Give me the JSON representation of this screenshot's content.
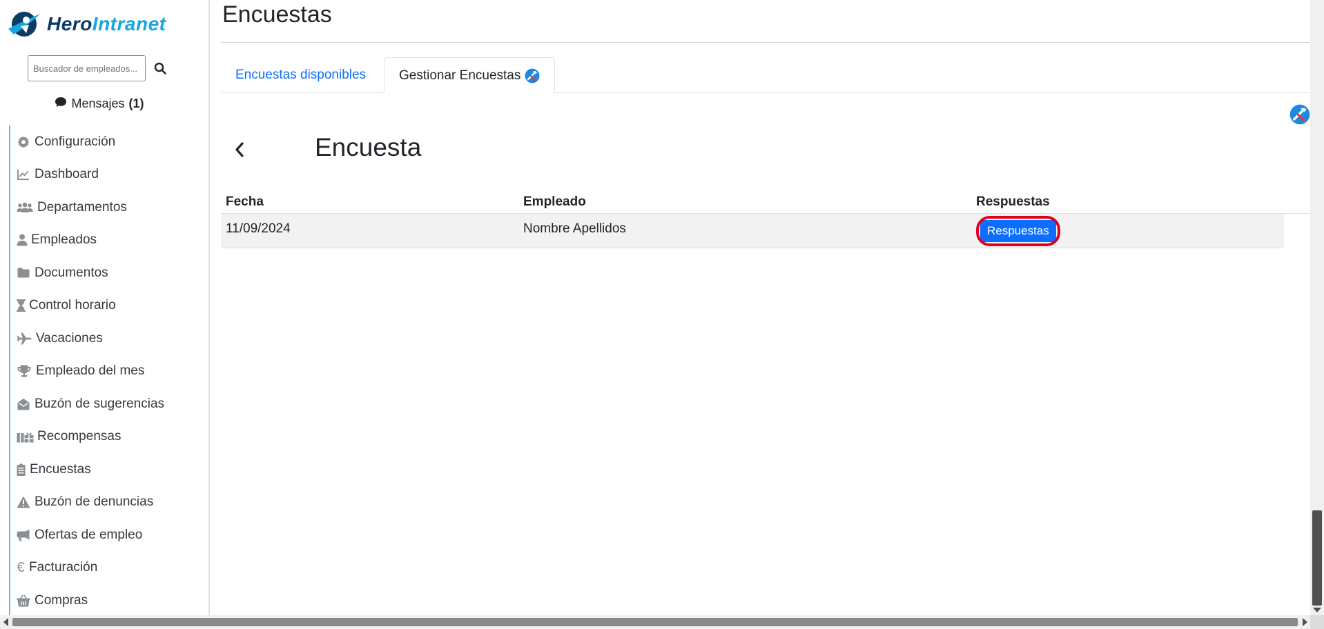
{
  "brand": {
    "part1": "Hero",
    "part2": "Intranet",
    "icon": "hero-logo-icon"
  },
  "search": {
    "placeholder": "Buscador de empleados...",
    "icon": "search-icon"
  },
  "messages": {
    "label": "Mensajes",
    "count": "(1)",
    "icon": "chat-bubble-icon"
  },
  "sidebar": {
    "items": [
      {
        "label": "Configuración",
        "icon": "gear-icon"
      },
      {
        "label": "Dashboard",
        "icon": "chart-line-icon"
      },
      {
        "label": "Departamentos",
        "icon": "users-icon"
      },
      {
        "label": "Empleados",
        "icon": "user-icon"
      },
      {
        "label": "Documentos",
        "icon": "folder-icon"
      },
      {
        "label": "Control horario",
        "icon": "hourglass-icon"
      },
      {
        "label": "Vacaciones",
        "icon": "plane-icon"
      },
      {
        "label": "Empleado del mes",
        "icon": "trophy-icon"
      },
      {
        "label": "Buzón de sugerencias",
        "icon": "envelope-open-icon"
      },
      {
        "label": "Recompensas",
        "icon": "gifts-icon"
      },
      {
        "label": "Encuestas",
        "icon": "clipboard-list-icon"
      },
      {
        "label": "Buzón de denuncias",
        "icon": "warning-icon"
      },
      {
        "label": "Ofertas de empleo",
        "icon": "megaphone-icon"
      },
      {
        "label": "Facturación",
        "icon": "euro-icon"
      },
      {
        "label": "Compras",
        "icon": "basket-icon"
      }
    ]
  },
  "page": {
    "title": "Encuestas"
  },
  "tabs": [
    {
      "label": "Encuestas disponibles",
      "active": false
    },
    {
      "label": "Gestionar Encuestas",
      "active": true,
      "icon": "tools-icon"
    }
  ],
  "survey": {
    "title": "Encuesta",
    "back_icon": "chevron-left-icon"
  },
  "table": {
    "headers": [
      "Fecha",
      "Empleado",
      "Respuestas"
    ],
    "rows": [
      {
        "date": "11/09/2024",
        "employee": "Nombre Apellidos",
        "action": "Respuestas"
      }
    ]
  },
  "colors": {
    "accent": "#0d6efd",
    "brand_dark": "#0d3b66",
    "brand_light": "#18a6e0",
    "highlight_ring": "#e0001a",
    "nav_border": "#5ec0e6"
  }
}
